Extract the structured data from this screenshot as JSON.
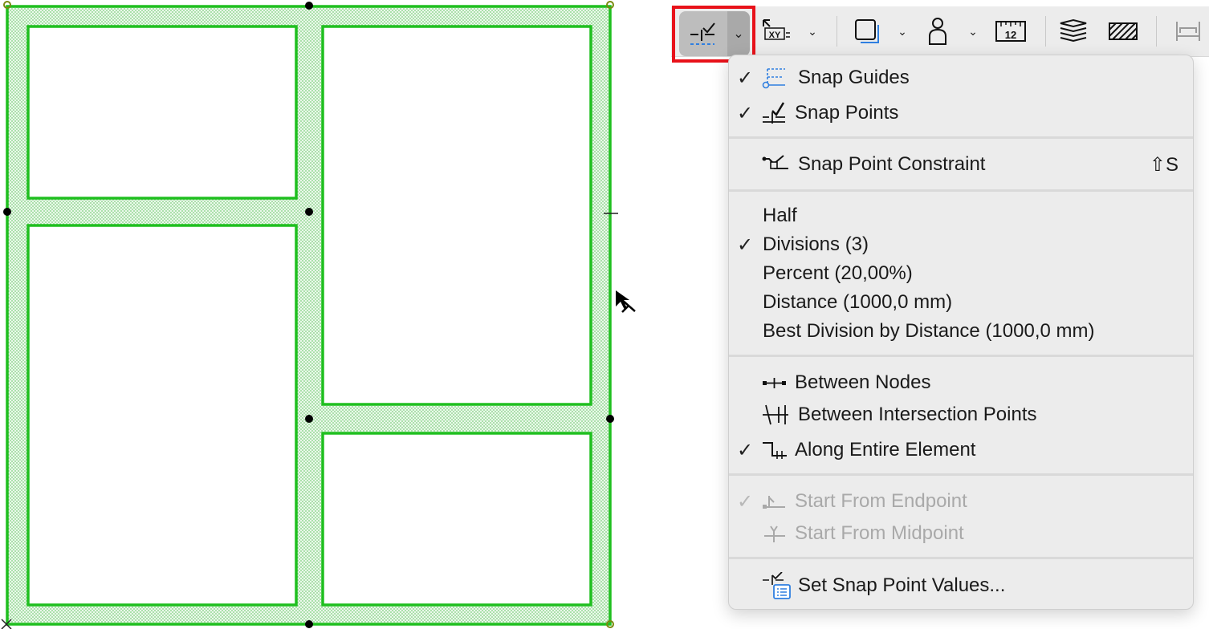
{
  "menu": {
    "items": [
      {
        "key": "snap_guides",
        "label": "Snap Guides",
        "checked": true,
        "icon": "snap-guides-icon"
      },
      {
        "key": "snap_points",
        "label": "Snap Points",
        "checked": true,
        "icon": "snap-points-icon"
      },
      {
        "key": "snap_constraint",
        "label": "Snap Point Constraint",
        "checked": false,
        "icon": "snap-constraint-icon",
        "shortcut": "⇧S"
      },
      {
        "key": "half",
        "label": "Half",
        "checked": false
      },
      {
        "key": "divisions",
        "label": "Divisions (3)",
        "checked": true
      },
      {
        "key": "percent",
        "label": "Percent (20,00%)",
        "checked": false
      },
      {
        "key": "distance",
        "label": "Distance (1000,0 mm)",
        "checked": false
      },
      {
        "key": "best_division",
        "label": "Best Division by Distance (1000,0 mm)",
        "checked": false
      },
      {
        "key": "between_nodes",
        "label": "Between Nodes",
        "checked": false,
        "icon": "between-nodes-icon"
      },
      {
        "key": "between_intersections",
        "label": "Between Intersection Points",
        "checked": false,
        "icon": "between-intersections-icon"
      },
      {
        "key": "along_entire",
        "label": "Along Entire Element",
        "checked": true,
        "icon": "along-element-icon"
      },
      {
        "key": "start_endpoint",
        "label": "Start From Endpoint",
        "checked": true,
        "disabled": true,
        "icon": "start-endpoint-icon"
      },
      {
        "key": "start_midpoint",
        "label": "Start From Midpoint",
        "checked": false,
        "disabled": true,
        "icon": "start-midpoint-icon"
      },
      {
        "key": "set_values",
        "label": "Set Snap Point Values...",
        "checked": false,
        "icon": "set-values-icon"
      }
    ]
  },
  "toolbar": {
    "ruler_label": "12",
    "xy_label": "XY"
  },
  "colors": {
    "wall": "#1fbf1f",
    "highlight": "#e8121a",
    "guide": "#2f7fe0"
  }
}
